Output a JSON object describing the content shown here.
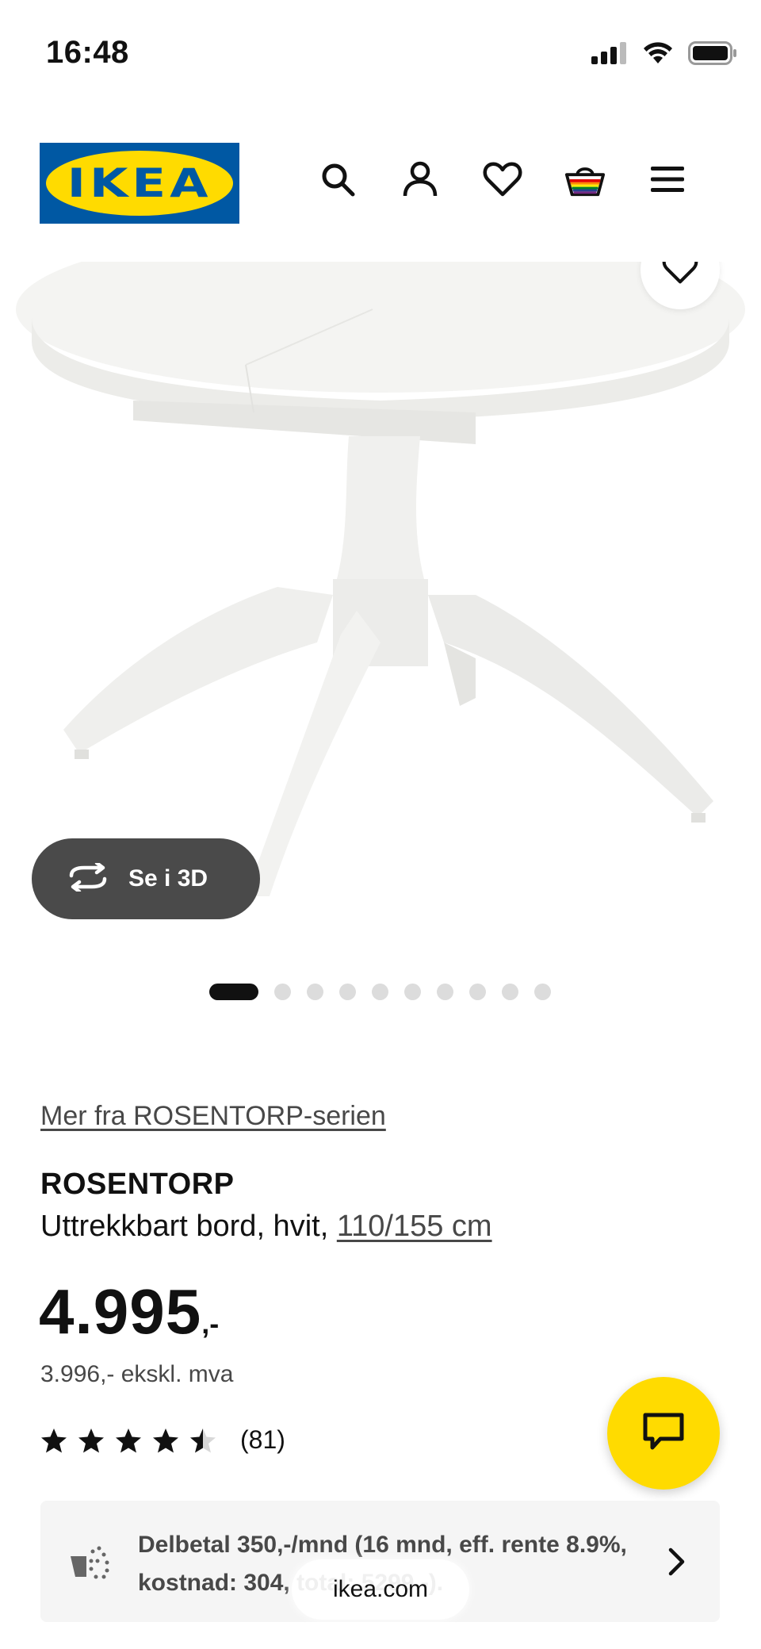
{
  "status_bar": {
    "time": "16:48",
    "icons": [
      "cellular-signal-icon",
      "wifi-icon",
      "battery-icon"
    ]
  },
  "header": {
    "logo_text": "IKEA",
    "icons": [
      "search-icon",
      "account-icon",
      "wishlist-heart-icon",
      "shopping-bag-icon",
      "menu-icon"
    ]
  },
  "hero": {
    "view3d_label": "Se i 3D",
    "image_count": 10,
    "active_index": 0
  },
  "product": {
    "series_link": "Mer fra ROSENTORP-serien",
    "name": "ROSENTORP",
    "description_prefix": "Uttrekkbart bord, hvit, ",
    "dimensions": "110/155 cm",
    "price_main": "4.995",
    "price_suffix": ",-",
    "price_ex_vat": "3.996,- ekskl. mva",
    "rating_value": 4.5,
    "rating_count": "(81)"
  },
  "finance": {
    "text": "Delbetal 350,-/mnd (16 mnd, eff. rente 8.9%, kostnad: 304, total: 5299,-)."
  },
  "browser": {
    "url": "ikea.com"
  },
  "colors": {
    "ikea_blue": "#0058a3",
    "ikea_yellow": "#ffdb00",
    "text_dark": "#111111",
    "text_muted": "#484848"
  }
}
